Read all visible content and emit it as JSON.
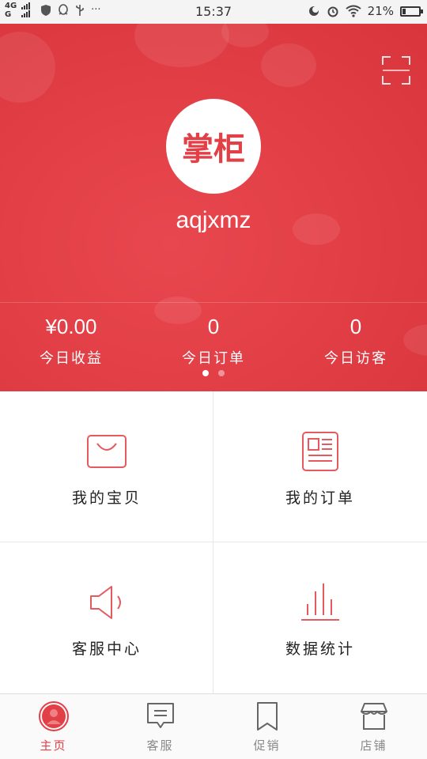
{
  "status_bar": {
    "network_top": "4G",
    "network_bottom": "G",
    "time": "15:37",
    "battery_percent": "21%",
    "battery_level": 0.21,
    "icons_left": [
      "shield-icon",
      "qq-icon",
      "usb-icon",
      "more-dots-icon"
    ],
    "icons_right": [
      "do-not-disturb-icon",
      "alarm-icon",
      "wifi-icon",
      "battery-icon"
    ],
    "more": "···"
  },
  "header": {
    "logo_text": "掌柜",
    "username": "aqjxmz",
    "scan_icon": "scan-icon",
    "accent_color": "#e23f46"
  },
  "stats": [
    {
      "value": "¥0.00",
      "label": "今日收益"
    },
    {
      "value": "0",
      "label": "今日订单"
    },
    {
      "value": "0",
      "label": "今日访客"
    }
  ],
  "pager": {
    "pages": 2,
    "active": 0
  },
  "grid": [
    {
      "label": "我的宝贝",
      "icon": "shopping-bag-icon"
    },
    {
      "label": "我的订单",
      "icon": "order-document-icon"
    },
    {
      "label": "客服中心",
      "icon": "speaker-icon"
    },
    {
      "label": "数据统计",
      "icon": "bar-chart-icon"
    }
  ],
  "tabs": [
    {
      "label": "主页",
      "icon": "home-avatar-icon",
      "active": true
    },
    {
      "label": "客服",
      "icon": "chat-icon",
      "active": false
    },
    {
      "label": "促销",
      "icon": "bookmark-icon",
      "active": false
    },
    {
      "label": "店铺",
      "icon": "store-icon",
      "active": false
    }
  ]
}
